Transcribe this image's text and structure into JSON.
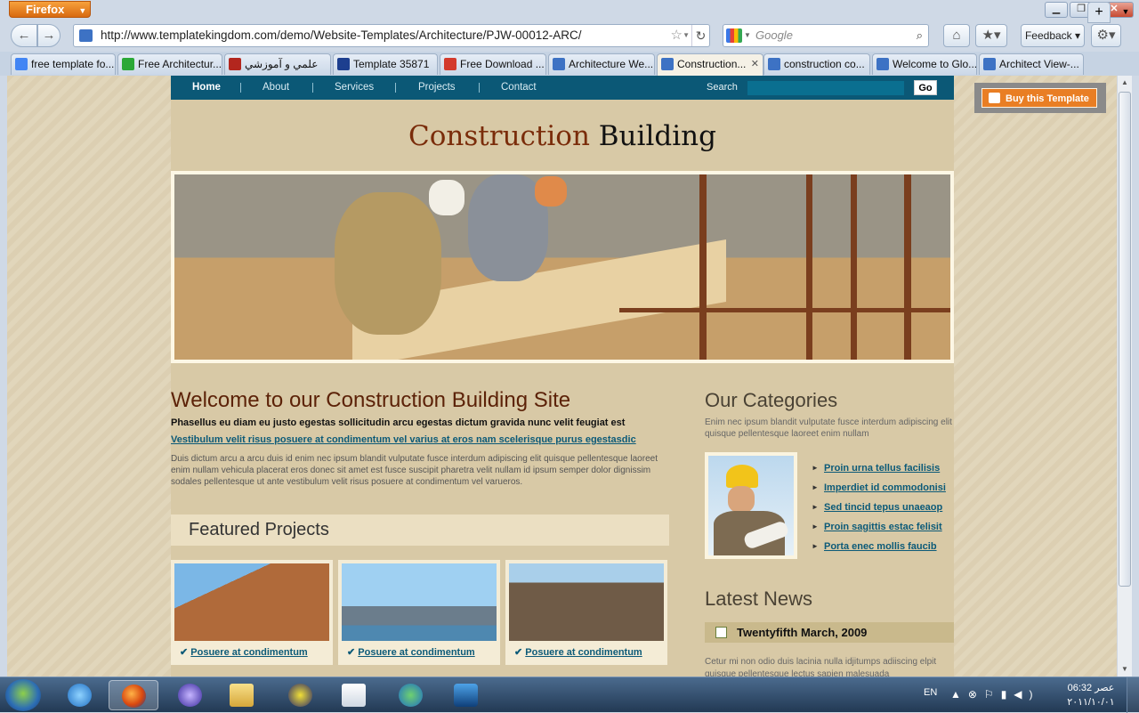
{
  "browser": {
    "app_button": "Firefox",
    "url": "http://www.templatekingdom.com/demo/Website-Templates/Architecture/PJW-00012-ARC/",
    "search_placeholder": "Google",
    "feedback_label": "Feedback",
    "tabs": [
      {
        "label": "free template fo...",
        "icon_color": "#4285f4",
        "active": false
      },
      {
        "label": "Free Architectur...",
        "icon_color": "#2aa836",
        "active": false
      },
      {
        "label": "علمي و آموزشي",
        "icon_color": "#b3261e",
        "active": false
      },
      {
        "label": "Template 35871",
        "icon_color": "#1d3f8f",
        "active": false
      },
      {
        "label": "Free Download ...",
        "icon_color": "#d33a2c",
        "active": false
      },
      {
        "label": "Architecture We...",
        "icon_color": "#3d72c4",
        "active": false
      },
      {
        "label": "Construction...",
        "icon_color": "#3d72c4",
        "active": true
      },
      {
        "label": "construction co...",
        "icon_color": "#3d72c4",
        "active": false
      },
      {
        "label": "Welcome to Glo...",
        "icon_color": "#3d72c4",
        "active": false
      },
      {
        "label": "Architect View-...",
        "icon_color": "#3d72c4",
        "active": false
      }
    ]
  },
  "site": {
    "nav": [
      "Home",
      "About",
      "Services",
      "Projects",
      "Contact"
    ],
    "search_label": "Search",
    "go_label": "Go",
    "buy_label": "Buy this Template",
    "logo_part1": "Construction",
    "logo_part2": "Building",
    "welcome": {
      "title": "Welcome to our Construction Building Site",
      "bold": "Phasellus eu diam eu justo egestas sollicitudin arcu egestas dictum gravida nunc velit feugiat est",
      "link": "Vestibulum velit risus posuere at condimentum vel varius at eros nam scelerisque purus egestasdic",
      "body": "Duis dictum arcu a arcu duis id enim nec ipsum blandit vulputate fusce interdum adipiscing elit quisque pellentesque laoreet enim nullam vehicula placerat eros donec sit amet est fusce suscipit pharetra velit nullam id ipsum semper dolor dignissim sodales pellentesque ut ante vestibulum velit risus posuere at condimentum vel varueros."
    },
    "featured": {
      "title": "Featured Projects",
      "items": [
        {
          "caption": "Posuere at condimentum"
        },
        {
          "caption": "Posuere at condimentum"
        },
        {
          "caption": "Posuere at condimentum"
        }
      ]
    },
    "categories": {
      "title": "Our Categories",
      "desc": "Enim nec ipsum blandit vulputate fusce interdum adipiscing elit quisque pellentesque laoreet enim nullam",
      "items": [
        "Proin urna tellus facilisis",
        "Imperdiet id commodonisi",
        "Sed tincid tepus unaeaop",
        "Proin sagittis estac felisit",
        "Porta enec mollis faucib"
      ]
    },
    "news": {
      "title": "Latest News",
      "date": "Twentyfifth March, 2009",
      "body": "Cetur mi non odio duis lacinia nulla idjitumps adiiscing elpit quisque pellentesque lectus sapien malesuada"
    }
  },
  "taskbar": {
    "lang": "EN",
    "time": "06:32 عصر",
    "date": "۲۰۱۱/۱۰/۰۱"
  }
}
